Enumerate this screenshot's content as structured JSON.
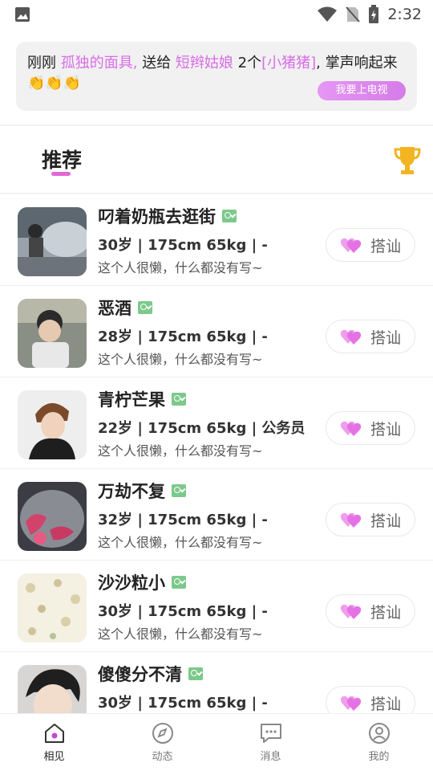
{
  "status_bar": {
    "time": "2:32"
  },
  "banner": {
    "prefix": "刚刚 ",
    "sender": "孤独的面具,",
    "mid": " 送给 ",
    "receiver": "短辫姑娘",
    "count_text": " 2个",
    "gift": "[小猪猪]",
    "suffix": ", 掌声响起来",
    "emoji": "👏👏👏",
    "button_label": "我要上电视"
  },
  "tabs": {
    "active_label": "推荐"
  },
  "list": [
    {
      "name": "叼着奶瓶去逛街",
      "info": "30岁 | 175cm 65kg | -",
      "desc": "这个人很懒，什么都没有写~",
      "button": "搭讪"
    },
    {
      "name": "恶酒",
      "info": "28岁 | 175cm 65kg | -",
      "desc": "这个人很懒，什么都没有写~",
      "button": "搭讪"
    },
    {
      "name": "青柠芒果",
      "info": "22岁 | 175cm 65kg | 公务员",
      "desc": "这个人很懒，什么都没有写~",
      "button": "搭讪"
    },
    {
      "name": "万劫不复",
      "info": "32岁 | 175cm 65kg | -",
      "desc": "这个人很懒，什么都没有写~",
      "button": "搭讪"
    },
    {
      "name": "沙沙粒小",
      "info": "30岁 | 175cm 65kg | -",
      "desc": "这个人很懒，什么都没有写~",
      "button": "搭讪"
    },
    {
      "name": "傻傻分不清",
      "info": "30岁 | 175cm 65kg | -",
      "desc": "",
      "button": "搭讪"
    }
  ],
  "tabbar": [
    {
      "label": "相见",
      "icon": "home-icon",
      "active": true
    },
    {
      "label": "动态",
      "icon": "compass-icon"
    },
    {
      "label": "消息",
      "icon": "chat-bubble-icon"
    },
    {
      "label": "我的",
      "icon": "user-icon"
    }
  ],
  "colors": {
    "accent": "#d96de6",
    "heart": "#ee82e6",
    "trophy": "#f2b420"
  }
}
